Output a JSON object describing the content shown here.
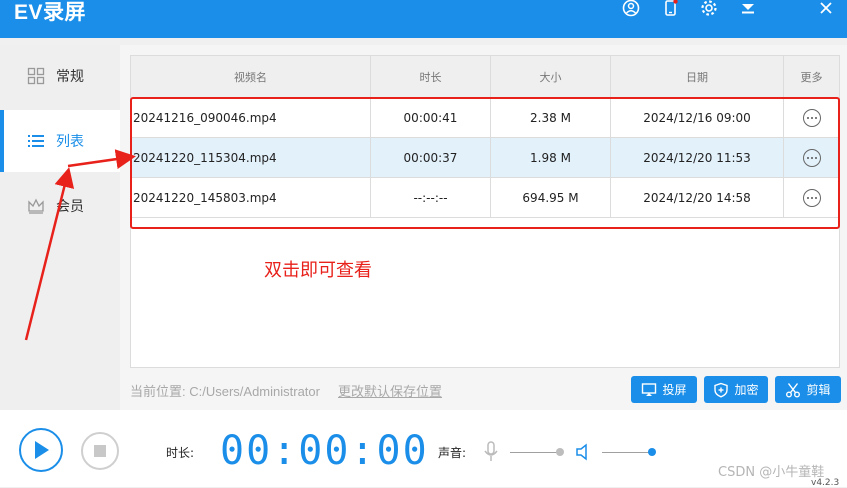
{
  "app": {
    "title": "EV录屏"
  },
  "sidebar": {
    "items": [
      {
        "label": "常规",
        "icon": "grid-icon"
      },
      {
        "label": "列表",
        "icon": "list-icon"
      },
      {
        "label": "会员",
        "icon": "crown-icon"
      }
    ],
    "active_index": 1
  },
  "table": {
    "headers": [
      "视频名",
      "时长",
      "大小",
      "日期",
      "更多"
    ],
    "rows": [
      {
        "name": "20241216_090046.mp4",
        "duration": "00:00:41",
        "size": "2.38 M",
        "date": "2024/12/16 09:00"
      },
      {
        "name": "20241220_115304.mp4",
        "duration": "00:00:37",
        "size": "1.98 M",
        "date": "2024/12/20 11:53"
      },
      {
        "name": "20241220_145803.mp4",
        "duration": "--:--:--",
        "size": "694.95 M",
        "date": "2024/12/20 14:58"
      }
    ],
    "selected_row_index": 1
  },
  "annotation": {
    "note": "双击即可查看",
    "color": "#e8211b"
  },
  "location": {
    "label": "当前位置:  C:/Users/Administrator",
    "change_link": "更改默认保存位置"
  },
  "actions": {
    "cast": "投屏",
    "encrypt": "加密",
    "edit": "剪辑"
  },
  "footer": {
    "duration_label": "时长:",
    "timer": "00:00:00",
    "sound_label": "声音:",
    "watermark": "CSDN @小牛童鞋",
    "version": "v4.2.3"
  },
  "colors": {
    "accent": "#1a8ee8",
    "annotation": "#e8211b"
  }
}
